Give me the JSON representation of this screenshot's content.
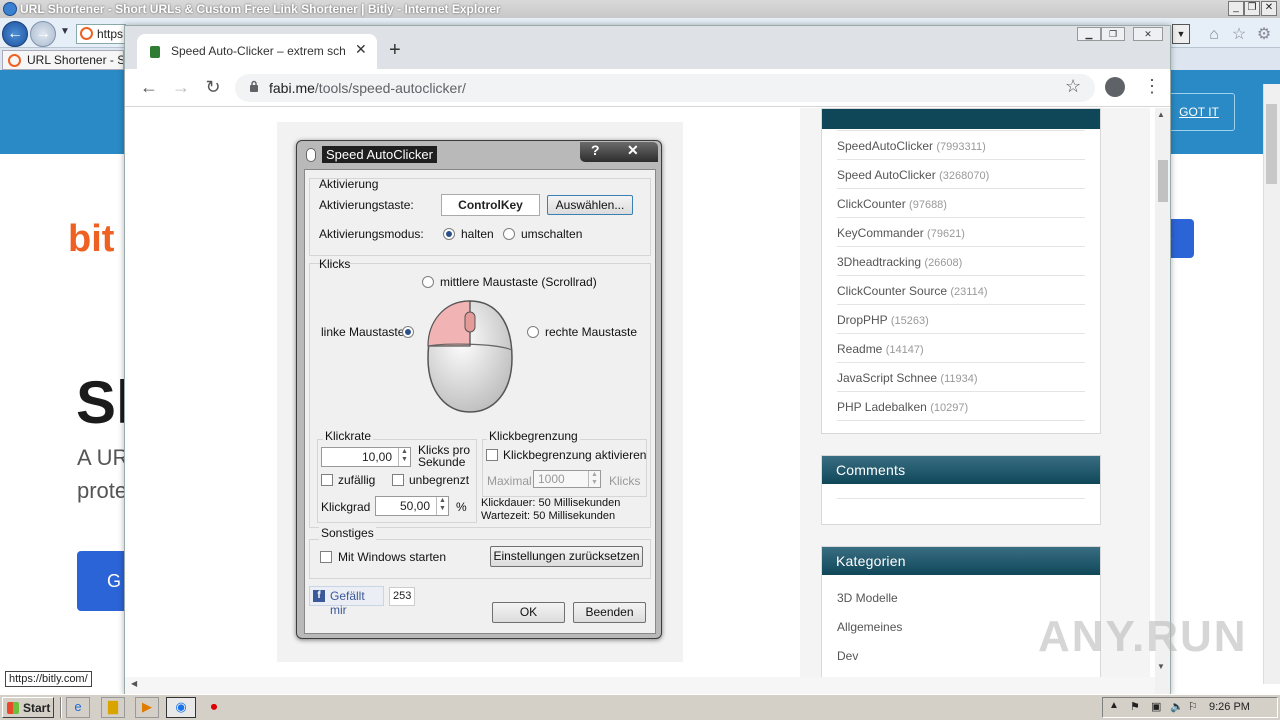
{
  "ie": {
    "title": "URL Shortener - Short URLs & Custom Free Link Shortener | Bitly - Internet Explorer",
    "address": "https",
    "tab_label": "URL Shortener - Shor",
    "got_it": "GOT IT",
    "logo": "bit",
    "headline": "Sl",
    "sub1": "A UR",
    "sub2": "prote",
    "cta": "G",
    "side_btn": "e",
    "status_tip": "https://bitly.com/"
  },
  "chrome": {
    "tab_title": "Speed Auto-Clicker – extrem schnell",
    "url_host": "fabi.me",
    "url_path": "/tools/speed-autoclicker/"
  },
  "sidebar": {
    "tools": [
      {
        "name": "SpeedAutoClicker",
        "count": "(7993311)"
      },
      {
        "name": "Speed AutoClicker",
        "count": "(3268070)"
      },
      {
        "name": "ClickCounter",
        "count": "(97688)"
      },
      {
        "name": "KeyCommander",
        "count": "(79621)"
      },
      {
        "name": "3Dheadtracking",
        "count": "(26608)"
      },
      {
        "name": "ClickCounter Source",
        "count": "(23114)"
      },
      {
        "name": "DropPHP",
        "count": "(15263)"
      },
      {
        "name": "Readme",
        "count": "(14147)"
      },
      {
        "name": "JavaScript Schnee",
        "count": "(11934)"
      },
      {
        "name": "PHP Ladebalken",
        "count": "(10297)"
      }
    ],
    "comments_title": "Comments",
    "categories_title": "Kategorien",
    "categories": [
      "3D Modelle",
      "Allgemeines",
      "Dev"
    ]
  },
  "dialog": {
    "title": "Speed AutoClicker",
    "help": "?",
    "close": "✕",
    "aktivierung": {
      "group": "Aktivierung",
      "key_label": "Aktivierungstaste:",
      "key_value": "ControlKey",
      "choose_button": "Auswählen...",
      "mode_label": "Aktivierungsmodus:",
      "mode_hold": "halten",
      "mode_toggle": "umschalten"
    },
    "klicks": {
      "group": "Klicks",
      "middle": "mittlere Maustaste (Scrollrad)",
      "left": "linke Maustaste",
      "right": "rechte Maustaste"
    },
    "klickrate": {
      "group": "Klickrate",
      "value": "10,00",
      "unit": "Klicks pro Sekunde",
      "random": "zufällig",
      "unlimited": "unbegrenzt",
      "grad_label": "Klickgrad",
      "grad_value": "50,00",
      "grad_unit": "%"
    },
    "begrenzung": {
      "group": "Klickbegrenzung",
      "activate": "Klickbegrenzung aktivieren",
      "max_label": "Maximal",
      "max_value": "1000",
      "max_unit": "Klicks",
      "duration": "Klickdauer: 50 Millisekunden",
      "wait": "Wartezeit: 50 Millisekunden"
    },
    "sonstiges": {
      "group": "Sonstiges",
      "autostart": "Mit Windows starten",
      "reset_button": "Einstellungen zurücksetzen"
    },
    "like_label": "Gefällt mir",
    "like_count": "253",
    "ok_button": "OK",
    "exit_button": "Beenden"
  },
  "watermark": "ANY.RUN",
  "taskbar": {
    "start": "Start",
    "clock": "9:26 PM"
  }
}
